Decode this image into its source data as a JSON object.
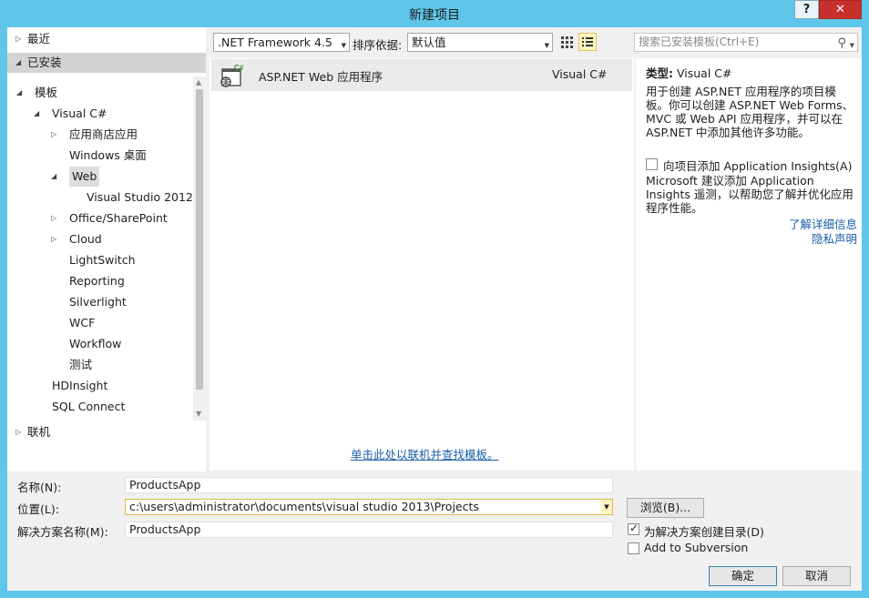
{
  "window": {
    "title": "新建项目",
    "help": "?",
    "close": "✕"
  },
  "tree": {
    "recent": "最近",
    "installed": "已安装",
    "online": "联机",
    "items": [
      {
        "label": "模板",
        "level": 1,
        "arrow": "▲"
      },
      {
        "label": "Visual C#",
        "level": 2,
        "arrow": "▲"
      },
      {
        "label": "应用商店应用",
        "level": 3,
        "arrow": "▷"
      },
      {
        "label": "Windows 桌面",
        "level": 3,
        "arrow": ""
      },
      {
        "label": "Web",
        "level": 3,
        "arrow": "▲",
        "selected": true
      },
      {
        "label": "Visual Studio 2012",
        "level": 4,
        "arrow": ""
      },
      {
        "label": "Office/SharePoint",
        "level": 3,
        "arrow": "▷"
      },
      {
        "label": "Cloud",
        "level": 3,
        "arrow": "▷"
      },
      {
        "label": "LightSwitch",
        "level": 3,
        "arrow": ""
      },
      {
        "label": "Reporting",
        "level": 3,
        "arrow": ""
      },
      {
        "label": "Silverlight",
        "level": 3,
        "arrow": ""
      },
      {
        "label": "WCF",
        "level": 3,
        "arrow": ""
      },
      {
        "label": "Workflow",
        "level": 3,
        "arrow": ""
      },
      {
        "label": "测试",
        "level": 3,
        "arrow": ""
      },
      {
        "label": "HDInsight",
        "level": 2,
        "arrow": ""
      },
      {
        "label": "SQL Connect",
        "level": 2,
        "arrow": ""
      }
    ]
  },
  "toolbar": {
    "framework": ".NET Framework 4.5",
    "sort_label": "排序依据:",
    "sort_value": "默认值",
    "search_placeholder": "搜索已安装模板(Ctrl+E)"
  },
  "templates": [
    {
      "name": "ASP.NET Web 应用程序",
      "lang": "Visual C#",
      "badge": "C#"
    }
  ],
  "online_link": "单击此处以联机并查找模板。",
  "details": {
    "type_label": "类型:",
    "type_value": "Visual C#",
    "description": "用于创建 ASP.NET 应用程序的项目模板。你可以创建 ASP.NET Web Forms、MVC 或 Web API 应用程序，并可以在 ASP.NET 中添加其他许多功能。",
    "ai_checkbox": "向项目添加 Application Insights(A)",
    "ai_checked": false,
    "ai_desc": "Microsoft 建议添加 Application Insights 遥测，以帮助您了解并优化应用程序性能。",
    "more_link": "了解详细信息",
    "privacy_link": "隐私声明"
  },
  "form": {
    "name_label": "名称(N):",
    "name_value": "ProductsApp",
    "location_label": "位置(L):",
    "location_value": "c:\\users\\administrator\\documents\\visual studio 2013\\Projects",
    "solution_label": "解决方案名称(M):",
    "solution_value": "ProductsApp",
    "browse": "浏览(B)...",
    "create_dir": "为解决方案创建目录(D)",
    "create_dir_checked": true,
    "add_svn": "Add to Subversion",
    "add_svn_checked": false,
    "ok": "确定",
    "cancel": "取消"
  }
}
